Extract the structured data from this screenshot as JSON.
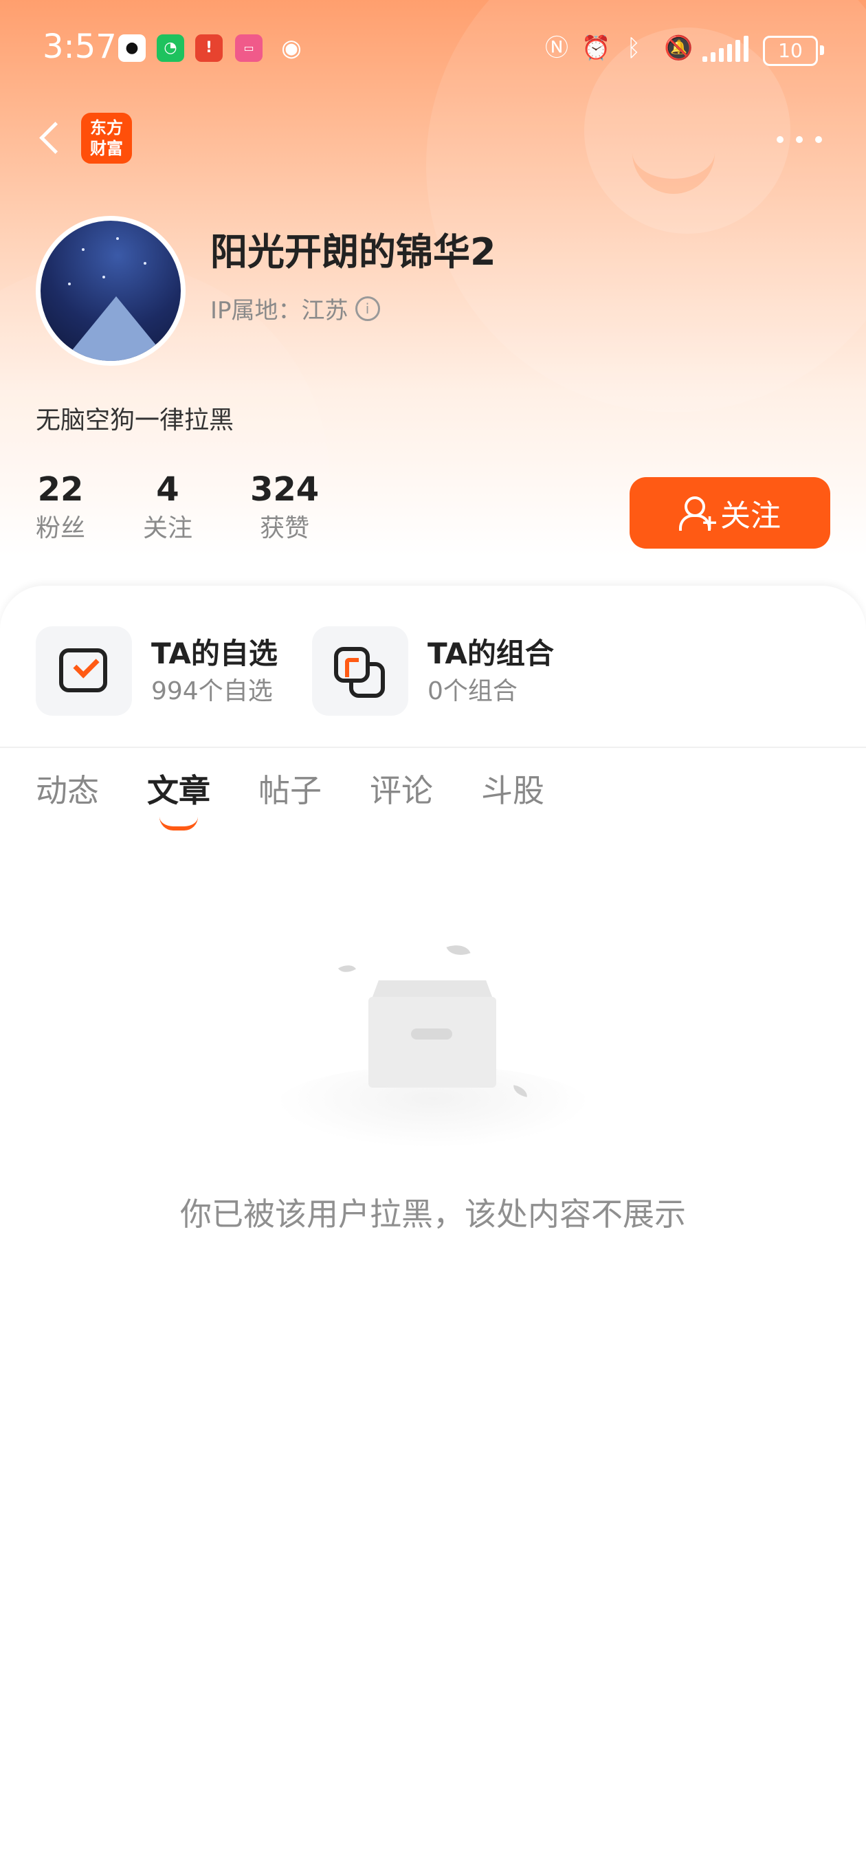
{
  "status_bar": {
    "time": "3:57",
    "battery": "10",
    "app_icons": [
      "qq-icon",
      "wechat-icon",
      "alert-app-icon",
      "bilibili-icon",
      "eye-icon"
    ],
    "system_icons": [
      "nfc-icon",
      "alarm-icon",
      "bluetooth-icon",
      "mute-icon",
      "signal-icon",
      "battery-icon"
    ]
  },
  "header": {
    "logo_line1": "东方",
    "logo_line2": "财富"
  },
  "profile": {
    "username": "阳光开朗的锦华2",
    "ip_label": "IP属地：江苏",
    "bio": "无脑空狗一律拉黑",
    "stats": [
      {
        "value": "22",
        "label": "粉丝"
      },
      {
        "value": "4",
        "label": "关注"
      },
      {
        "value": "324",
        "label": "获赞"
      }
    ],
    "follow_label": "关注"
  },
  "quick_links": [
    {
      "title": "TA的自选",
      "subtitle": "994个自选"
    },
    {
      "title": "TA的组合",
      "subtitle": "0个组合"
    }
  ],
  "tabs": [
    {
      "label": "动态"
    },
    {
      "label": "文章"
    },
    {
      "label": "帖子"
    },
    {
      "label": "评论"
    },
    {
      "label": "斗股"
    }
  ],
  "active_tab": "文章",
  "empty_state": {
    "message": "你已被该用户拉黑，该处内容不展示"
  },
  "colors": {
    "accent": "#ff5a14",
    "brand": "#ff4f0a",
    "hero_top": "#ff9f6e"
  }
}
